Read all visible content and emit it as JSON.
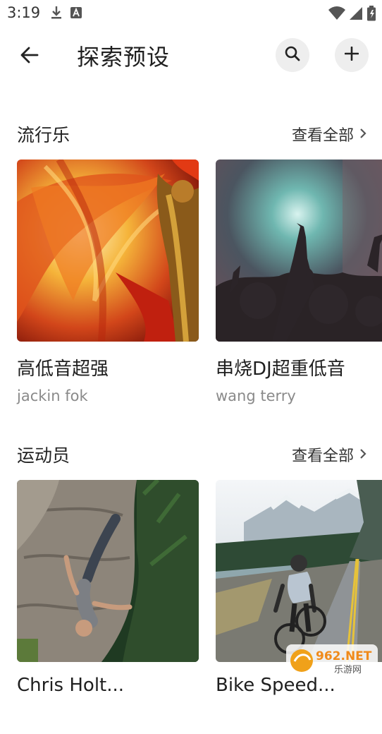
{
  "status": {
    "time": "3:19"
  },
  "header": {
    "title": "探索预设"
  },
  "sections": [
    {
      "title": "流行乐",
      "see_all": "查看全部",
      "cards": [
        {
          "title": "高低音超强",
          "author": "jackin fok"
        },
        {
          "title": "串烧DJ超重低音",
          "author": "wang terry"
        }
      ]
    },
    {
      "title": "运动员",
      "see_all": "查看全部",
      "cards": [
        {
          "title": "Chris Holt...",
          "author": ""
        },
        {
          "title": "Bike Speed...",
          "author": ""
        }
      ]
    }
  ],
  "watermark": {
    "number": "962.NET",
    "text": "乐游网"
  }
}
